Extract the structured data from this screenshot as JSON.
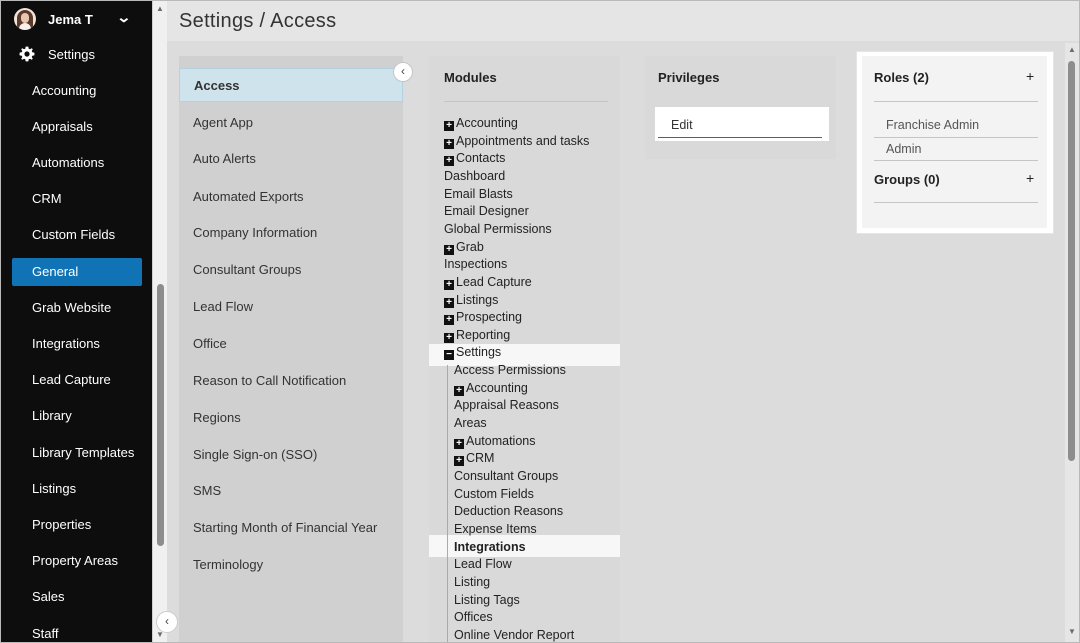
{
  "user": {
    "name": "Jema T"
  },
  "nav": {
    "section_label": "Settings",
    "items": [
      {
        "label": "Accounting",
        "active": false
      },
      {
        "label": "Appraisals",
        "active": false
      },
      {
        "label": "Automations",
        "active": false
      },
      {
        "label": "CRM",
        "active": false
      },
      {
        "label": "Custom Fields",
        "active": false
      },
      {
        "label": "General",
        "active": true
      },
      {
        "label": "Grab Website",
        "active": false
      },
      {
        "label": "Integrations",
        "active": false
      },
      {
        "label": "Lead Capture",
        "active": false
      },
      {
        "label": "Library",
        "active": false
      },
      {
        "label": "Library Templates",
        "active": false
      },
      {
        "label": "Listings",
        "active": false
      },
      {
        "label": "Properties",
        "active": false
      },
      {
        "label": "Property Areas",
        "active": false
      },
      {
        "label": "Sales",
        "active": false
      },
      {
        "label": "Staff",
        "active": false
      }
    ]
  },
  "page": {
    "title": "Settings / Access"
  },
  "categories": [
    {
      "label": "Access",
      "active": true
    },
    {
      "label": "Agent App",
      "active": false
    },
    {
      "label": "Auto Alerts",
      "active": false
    },
    {
      "label": "Automated Exports",
      "active": false
    },
    {
      "label": "Company Information",
      "active": false
    },
    {
      "label": "Consultant Groups",
      "active": false
    },
    {
      "label": "Lead Flow",
      "active": false
    },
    {
      "label": "Office",
      "active": false
    },
    {
      "label": "Reason to Call Notification",
      "active": false
    },
    {
      "label": "Regions",
      "active": false
    },
    {
      "label": "Single Sign-on (SSO)",
      "active": false
    },
    {
      "label": "SMS",
      "active": false
    },
    {
      "label": "Starting Month of Financial Year",
      "active": false
    },
    {
      "label": "Terminology",
      "active": false
    }
  ],
  "modules": {
    "title": "Modules",
    "items": [
      {
        "label": "Accounting",
        "toggle": "+",
        "level": 0
      },
      {
        "label": "Appointments and tasks",
        "toggle": "+",
        "level": 0
      },
      {
        "label": "Contacts",
        "toggle": "+",
        "level": 0
      },
      {
        "label": "Dashboard",
        "toggle": "",
        "level": 0
      },
      {
        "label": "Email Blasts",
        "toggle": "",
        "level": 0
      },
      {
        "label": "Email Designer",
        "toggle": "",
        "level": 0
      },
      {
        "label": "Global Permissions",
        "toggle": "",
        "level": 0
      },
      {
        "label": "Grab",
        "toggle": "+",
        "level": 0
      },
      {
        "label": "Inspections",
        "toggle": "",
        "level": 0
      },
      {
        "label": "Lead Capture",
        "toggle": "+",
        "level": 0
      },
      {
        "label": "Listings",
        "toggle": "+",
        "level": 0
      },
      {
        "label": "Prospecting",
        "toggle": "+",
        "level": 0
      },
      {
        "label": "Reporting",
        "toggle": "+",
        "level": 0
      },
      {
        "label": "Settings",
        "toggle": "−",
        "level": 0,
        "highlight": true
      },
      {
        "label": "Access Permissions",
        "toggle": "",
        "level": 1
      },
      {
        "label": "Accounting",
        "toggle": "+",
        "level": 1
      },
      {
        "label": "Appraisal Reasons",
        "toggle": "",
        "level": 1
      },
      {
        "label": "Areas",
        "toggle": "",
        "level": 1
      },
      {
        "label": "Automations",
        "toggle": "+",
        "level": 1
      },
      {
        "label": "CRM",
        "toggle": "+",
        "level": 1
      },
      {
        "label": "Consultant Groups",
        "toggle": "",
        "level": 1
      },
      {
        "label": "Custom Fields",
        "toggle": "",
        "level": 1
      },
      {
        "label": "Deduction Reasons",
        "toggle": "",
        "level": 1
      },
      {
        "label": "Expense Items",
        "toggle": "",
        "level": 1
      },
      {
        "label": "Integrations",
        "toggle": "",
        "level": 1,
        "highlight": true,
        "bold": true
      },
      {
        "label": "Lead Flow",
        "toggle": "",
        "level": 1
      },
      {
        "label": "Listing",
        "toggle": "",
        "level": 1
      },
      {
        "label": "Listing Tags",
        "toggle": "",
        "level": 1
      },
      {
        "label": "Offices",
        "toggle": "",
        "level": 1
      },
      {
        "label": "Online Vendor Report",
        "toggle": "",
        "level": 1
      }
    ]
  },
  "privileges": {
    "title": "Privileges",
    "items": [
      "Edit"
    ]
  },
  "roles": {
    "title": "Roles (2)",
    "add": "+",
    "items": [
      "Franchise Admin",
      "Admin"
    ],
    "groups_title": "Groups (0)",
    "groups_add": "+"
  },
  "icons": {
    "gear": "gear-icon",
    "chevron": "chevron-down-icon",
    "collapse": "chevron-left-icon"
  },
  "colors": {
    "nav_bg": "#0d0d0d",
    "accent": "#1073b5",
    "active_category": "#cfe3ed"
  }
}
